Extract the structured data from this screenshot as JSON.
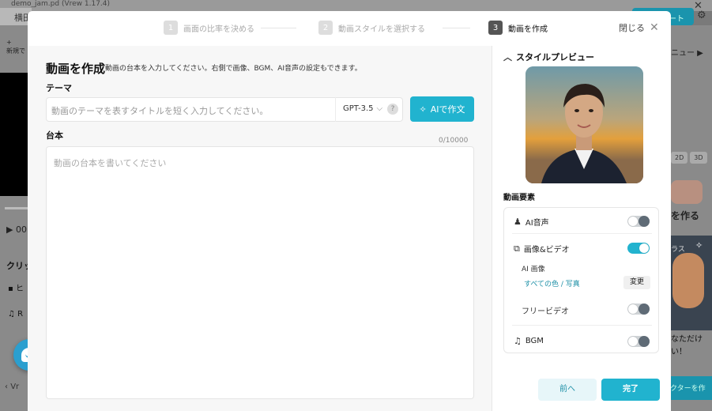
{
  "background": {
    "window_title": "demo_jam.pd (Vrew 1.17.4)",
    "tab_label": "横田",
    "support_label": "ポート",
    "new_label": "新規で",
    "time_label": "00",
    "clip_label": "クリッ",
    "row1_label": "ヒ",
    "row2_label": "R",
    "vr_label": "Vr",
    "menu_label": "ニュー",
    "badge_2d": "2D",
    "badge_3d": "3D",
    "make_label": "を作る",
    "plus_label": "ラス",
    "notice_text": "なただけ い！",
    "blue_btn_label": "クターを作"
  },
  "steps": [
    {
      "num": "1",
      "label": "画面の比率を決める",
      "active": false
    },
    {
      "num": "2",
      "label": "動画スタイルを選択する",
      "active": false
    },
    {
      "num": "3",
      "label": "動画を作成",
      "active": true
    }
  ],
  "header": {
    "close_label": "閉じる",
    "close_icon": "close-icon"
  },
  "form": {
    "title": "動画を作成",
    "subtitle": "動画の台本を入力してください。右側で画像、BGM、AI音声の設定もできます。",
    "theme_label": "テーマ",
    "theme_placeholder": "動画のテーマを表すタイトルを短く入力してください。",
    "model": "GPT-3.5",
    "help": "?",
    "ai_button": "AIで作文",
    "script_label": "台本",
    "counter": "0/10000",
    "script_placeholder": "動画の台本を書いてください"
  },
  "style_preview": {
    "header": "スタイルプレビュー"
  },
  "elements": {
    "header": "動画要素",
    "ai_voice": {
      "label": "AI音声",
      "enabled": false
    },
    "image_video": {
      "label": "画像&ビデオ",
      "enabled": true
    },
    "ai_image_label": "AI 画像",
    "ai_image_value": "すべての色 / 写真",
    "change_button": "変更",
    "free_video": {
      "label": "フリービデオ",
      "enabled": false
    },
    "bgm": {
      "label": "BGM",
      "enabled": false
    }
  },
  "footer": {
    "prev_button": "前へ",
    "done_button": "完了"
  },
  "colors": {
    "accent": "#21b3cf",
    "link": "#1c8fa6"
  }
}
